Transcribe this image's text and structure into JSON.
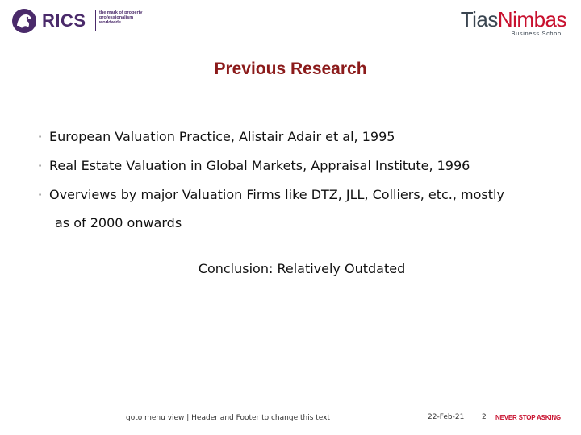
{
  "header": {
    "rics_logo": {
      "wordmark": "RICS",
      "tagline": "the mark of property professionalism worldwide",
      "color": "#4a2a6a"
    },
    "tias_logo": {
      "name_part1": "Tias",
      "name_part2": "Nimbas",
      "subtitle": "Business School",
      "accent": "#c8102e",
      "color": "#3a4550"
    }
  },
  "slide": {
    "title": "Previous Research",
    "title_color": "#8b1a1a",
    "bullets": [
      {
        "marker": "·",
        "text": "European Valuation Practice, Alistair Adair et al, 1995"
      },
      {
        "marker": "·",
        "text": "Real Estate Valuation in Global Markets, Appraisal Institute, 1996"
      },
      {
        "marker": "·",
        "text": "Overviews by major Valuation Firms like DTZ, JLL, Colliers, etc., mostly",
        "continuation": "as of 2000 onwards"
      }
    ],
    "conclusion": "Conclusion: Relatively Outdated"
  },
  "footer": {
    "note": "goto menu view | Header and Footer to change this text",
    "date": "22-Feb-21",
    "page": "2",
    "slogan": "NEVER STOP ASKING",
    "slogan_color": "#c8102e"
  }
}
